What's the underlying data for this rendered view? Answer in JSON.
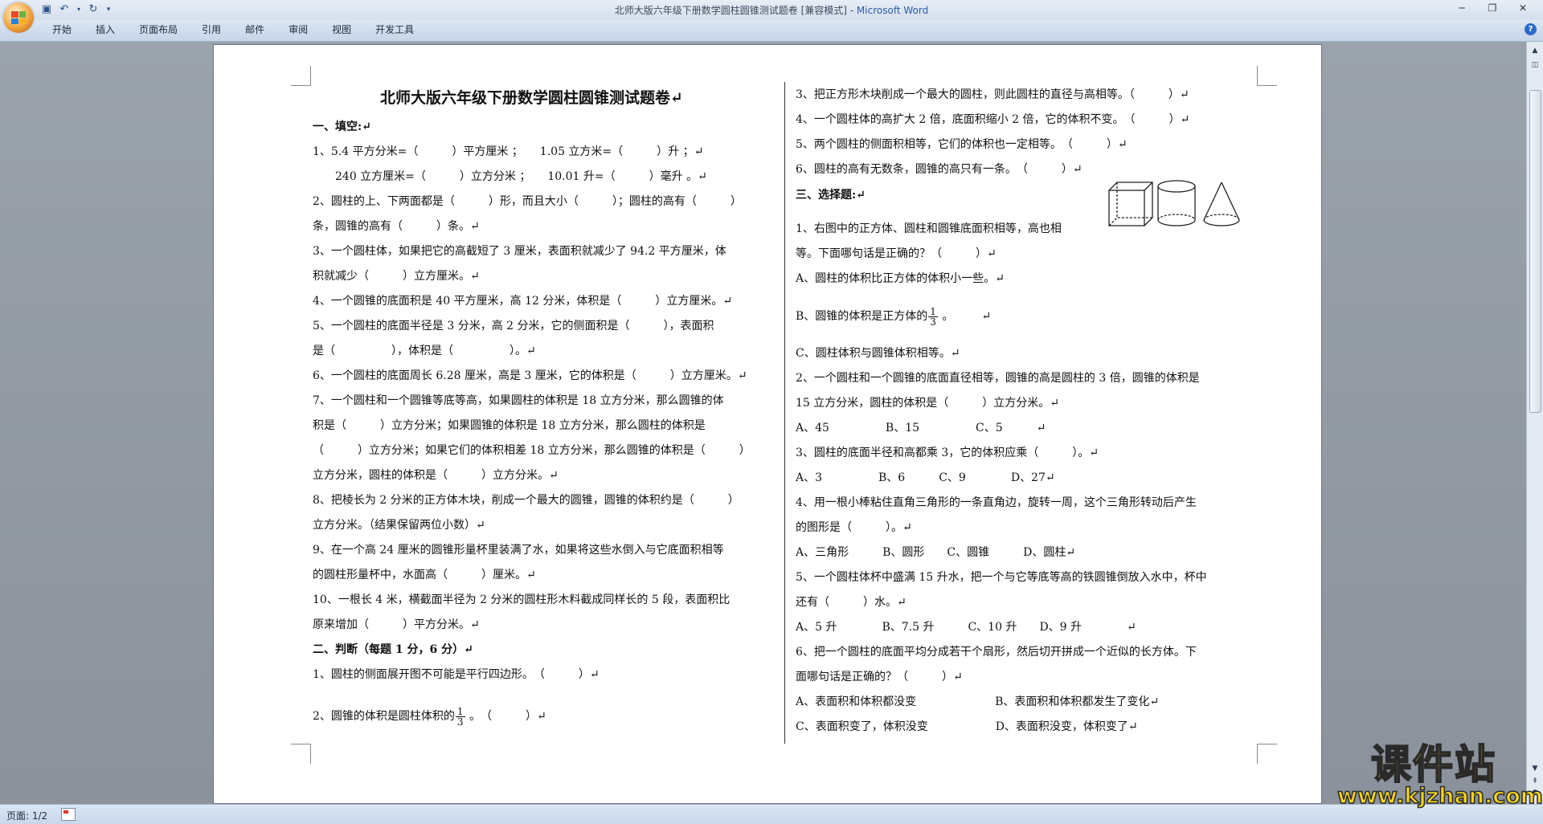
{
  "window": {
    "title": "北师大版六年级下册数学圆柱圆锥测试题卷 [兼容模式] - ",
    "app_name": "Microsoft Word"
  },
  "ribbon": {
    "tabs": [
      "开始",
      "插入",
      "页面布局",
      "引用",
      "邮件",
      "审阅",
      "视图",
      "开发工具"
    ]
  },
  "status": {
    "page": "页面: 1/2"
  },
  "watermark": {
    "cn": "课件站",
    "url": "www.kjzhan.com"
  },
  "document": {
    "title": "北师大版六年级下册数学圆柱圆锥测试题卷↵",
    "left_lines": [
      "一、填空:↵",
      "1、5.4 平方分米=（　　　）平方厘米 ；　　1.05 立方米=（　　　）升 ；↵",
      "　　240 立方厘米=（　　　）立方分米 ；　　10.01 升=（　　　）毫升 。↵",
      "2、圆柱的上、下两面都是（　　　）形，而且大小（　　　）；圆柱的高有（　　　）",
      "条，圆锥的高有（　　　）条。↵",
      "3、一个圆柱体，如果把它的高截短了 3 厘米，表面积就减少了 94.2 平方厘米，体",
      "积就减少（　　　）立方厘米。↵",
      "4、一个圆锥的底面积是 40 平方厘米，高 12 分米，体积是（　　　）立方厘米。↵",
      "5、一个圆柱的底面半径是 3 分米，高 2 分米，它的侧面积是（　　　），表面积",
      "是（　　　　　），体积是（　　　　　）。↵",
      "6、一个圆柱的底面周长 6.28 厘米，高是 3 厘米，它的体积是（　　　）立方厘米。↵",
      "7、一个圆柱和一个圆锥等底等高，如果圆柱的体积是 18 立方分米，那么圆锥的体",
      "积是（　　　）立方分米；如果圆锥的体积是 18 立方分米，那么圆柱的体积是",
      "（　　　）立方分米；如果它们的体积相差 18 立方分米，那么圆锥的体积是（　　　）",
      "立方分米，圆柱的体积是（　　　）立方分米。↵",
      "8、把棱长为 2 分米的正方体木块，削成一个最大的圆锥，圆锥的体积约是（　　　）",
      "立方分米。（结果保留两位小数）↵",
      "9、在一个高 24 厘米的圆锥形量杯里装满了水，如果将这些水倒入与它底面积相等",
      "的圆柱形量杯中，水面高（　　　）厘米。↵",
      "10、一根长 4 米，横截面半径为 2 分米的圆柱形木料截成同样长的 5 段，表面积比",
      "原来增加（　　　）平方分米。↵",
      "二、判断（每题 1 分，6 分）↵",
      "1、圆柱的侧面展开图不可能是平行四边形。　（　　　）↵"
    ],
    "left_frac_line": {
      "before": "2、圆锥的体积是圆柱体积的",
      "num": "1",
      "den": "3",
      "after": " 。　（　　　）↵"
    },
    "right_lines_top": [
      "3、把正方形木块削成一个最大的圆柱，则此圆柱的直径与高相等。（　　　）↵",
      "4、一个圆柱体的高扩大 2 倍，底面积缩小 2 倍，它的体积不变。　（　　　）↵",
      "5、两个圆柱的侧面积相等，它们的体积也一定相等。　（　　　）↵",
      "6、圆柱的高有无数条，圆锥的高只有一条。　（　　　）↵",
      "三、选择题:↵",
      "1、右图中的正方体、圆柱和圆锥底面积相等，高也相",
      "等。下面哪句话是正确的？（　　　）↵",
      "A、圆柱的体积比正方体的体积小一些。↵"
    ],
    "right_frac_line": {
      "before": "B、圆锥的体积是正方体的",
      "num": "1",
      "den": "3",
      "after": " 。　　　↵"
    },
    "right_lines_bottom": [
      "C、圆柱体积与圆锥体积相等。↵",
      "2、一个圆柱和一个圆锥的底面直径相等，圆锥的高是圆柱的 3 倍，圆锥的体积是",
      "15 立方分米，圆柱的体积是（　　　）立方分米。↵",
      "A、45　　　　　B、15　　　　　C、5　　　↵",
      "3、圆柱的底面半径和高都乘 3，它的体积应乘（　　　）。↵",
      "A、3　　　　　B、6　　　C、9　　　　D、27↵",
      "4、用一根小棒粘住直角三角形的一条直角边，旋转一周，这个三角形转动后产生",
      "的图形是（　　　）。↵",
      "A、三角形　　　B、圆形　　C、圆锥　　　D、圆柱↵",
      "5、一个圆柱体杯中盛满 15 升水，把一个与它等底等高的铁圆锥倒放入水中，杯中",
      "还有（　　　）水。↵",
      "A、5 升　　　　B、7.5 升　　　C、10 升　　D、9 升　　　　↵",
      "6、把一个圆柱的底面平均分成若干个扇形，然后切开拼成一个近似的长方体。下",
      "面哪句话是正确的？（　　　）↵",
      "A、表面积和体积都没变　　　　　　　B、表面积和体积都发生了变化↵",
      "C、表面积变了，体积没变　　　　　　D、表面积没变，体积变了↵"
    ]
  }
}
